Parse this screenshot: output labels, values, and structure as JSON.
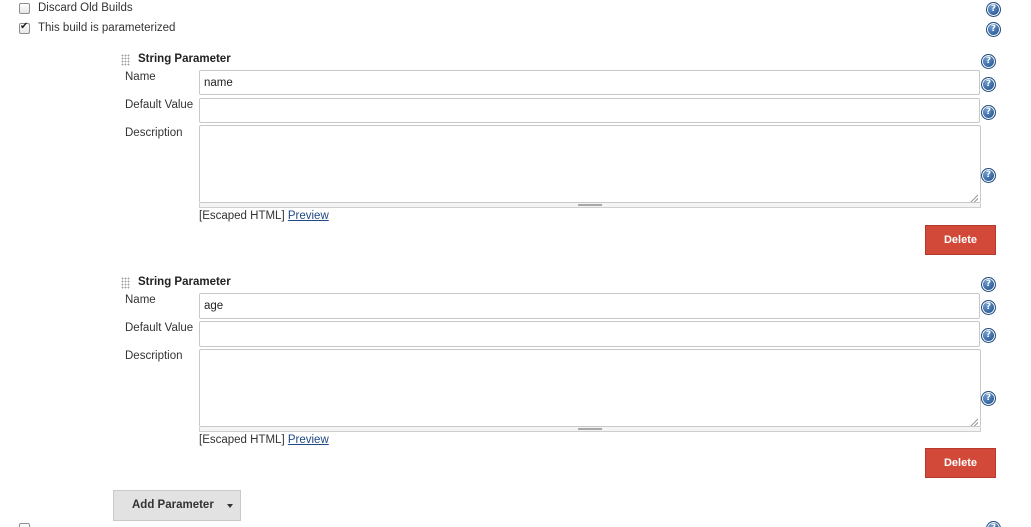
{
  "options": {
    "discard_old_builds": {
      "label": "Discard Old Builds",
      "checked": false
    },
    "parameterized": {
      "label": "This build is parameterized",
      "checked": true
    }
  },
  "parameters": [
    {
      "type_label": "String Parameter",
      "name_label": "Name",
      "name_value": "name",
      "default_label": "Default Value",
      "default_value": "",
      "description_label": "Description",
      "description_value": "",
      "escaped_note": "[Escaped HTML]",
      "preview_label": "Preview",
      "delete_label": "Delete"
    },
    {
      "type_label": "String Parameter",
      "name_label": "Name",
      "name_value": "age",
      "default_label": "Default Value",
      "default_value": "",
      "description_label": "Description",
      "description_value": "",
      "escaped_note": "[Escaped HTML]",
      "preview_label": "Preview",
      "delete_label": "Delete"
    }
  ],
  "add_parameter": {
    "label": "Add Parameter"
  },
  "colors": {
    "delete": "#d24939",
    "link": "#204a87",
    "help_icon": "#2d5f9a"
  },
  "icons": [
    "help-icon",
    "drag-handle-icon",
    "checkmark-icon",
    "caret-down-icon",
    "resize-grip-icon"
  ]
}
